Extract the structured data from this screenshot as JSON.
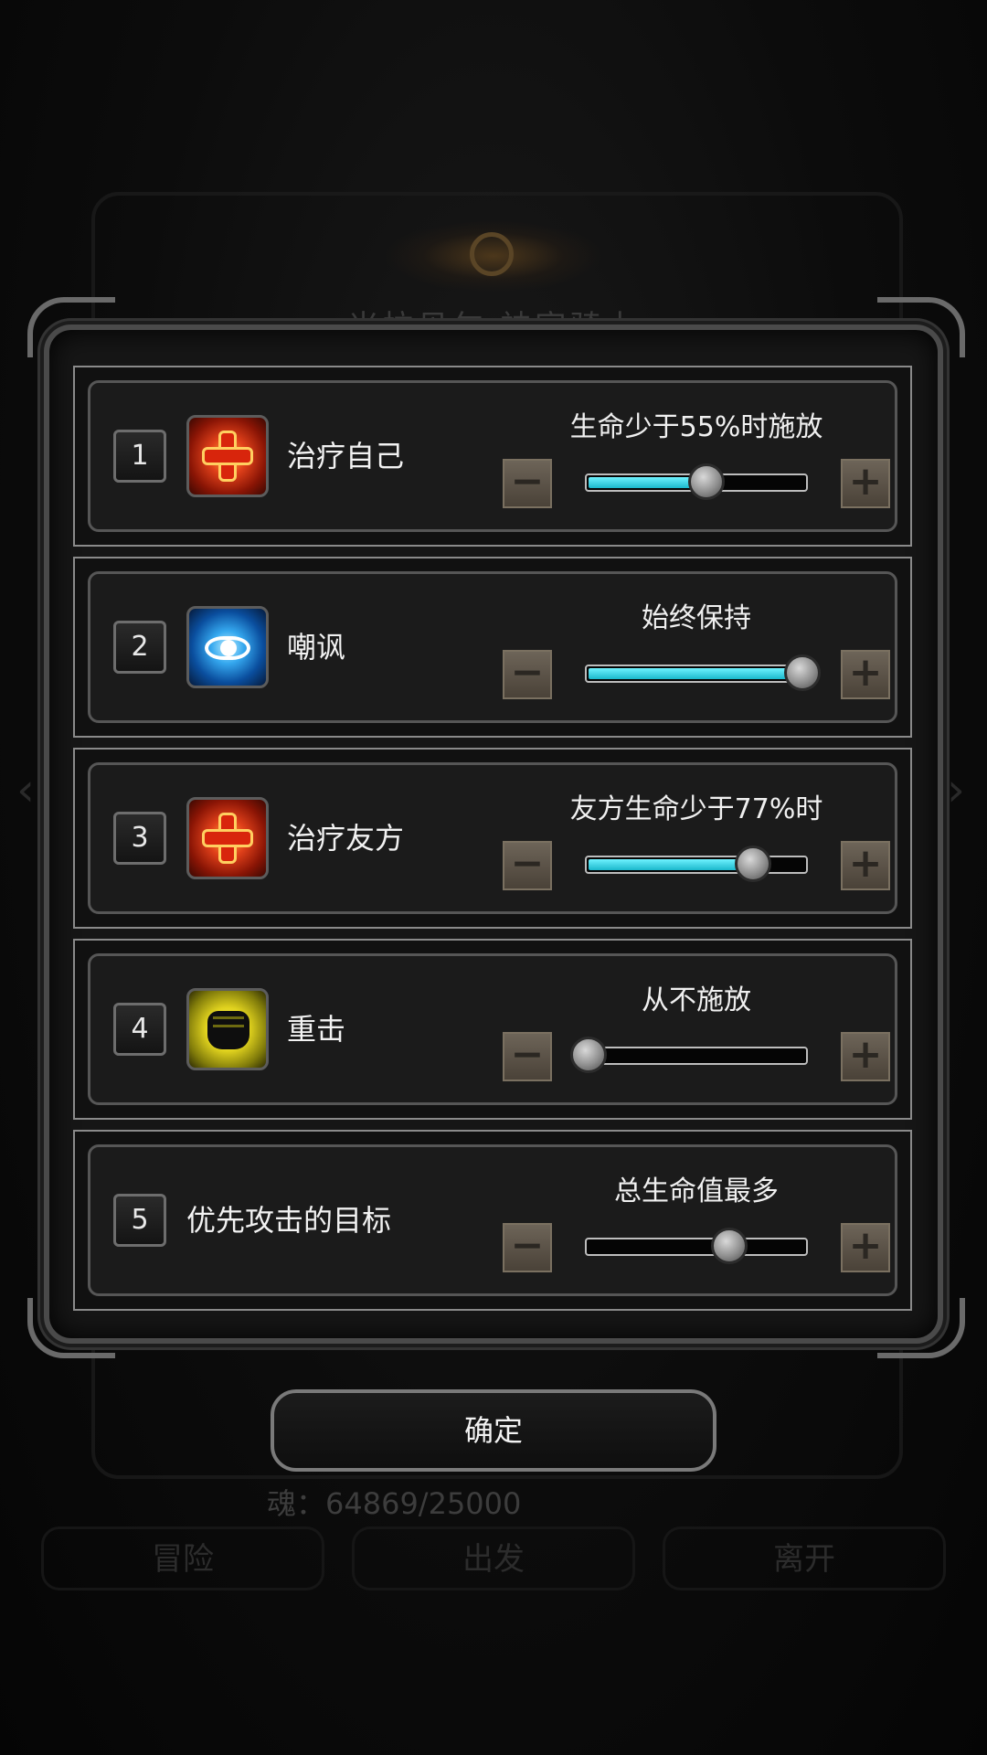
{
  "background": {
    "title": "米拉贝尔 神官骑士",
    "soul": "魂：64869/25000",
    "buttons": [
      "冒险",
      "出发",
      "离开"
    ]
  },
  "rules": [
    {
      "index": "1",
      "icon": "heal-cross-icon",
      "name": "治疗自己",
      "condition": "生命少于55%时施放",
      "level": 0.55
    },
    {
      "index": "2",
      "icon": "taunt-eye-icon",
      "name": "嘲讽",
      "condition": "始终保持",
      "level": 1.0
    },
    {
      "index": "3",
      "icon": "heal-cross-icon",
      "name": "治疗友方",
      "condition": "友方生命少于77%时",
      "level": 0.77
    },
    {
      "index": "4",
      "icon": "heavy-strike-fist-icon",
      "name": "重击",
      "condition": "从不施放",
      "level": 0.0
    },
    {
      "index": "5",
      "icon": null,
      "name": "优先攻击的目标",
      "condition": "总生命值最多",
      "level": 0.66
    }
  ],
  "controls": {
    "minus": "−",
    "plus": "+"
  },
  "confirm_label": "确定",
  "colors": {
    "slider_fill": "#2fd0e0",
    "panel_border": "#8a8a8a",
    "stepper": "#5b5248"
  }
}
